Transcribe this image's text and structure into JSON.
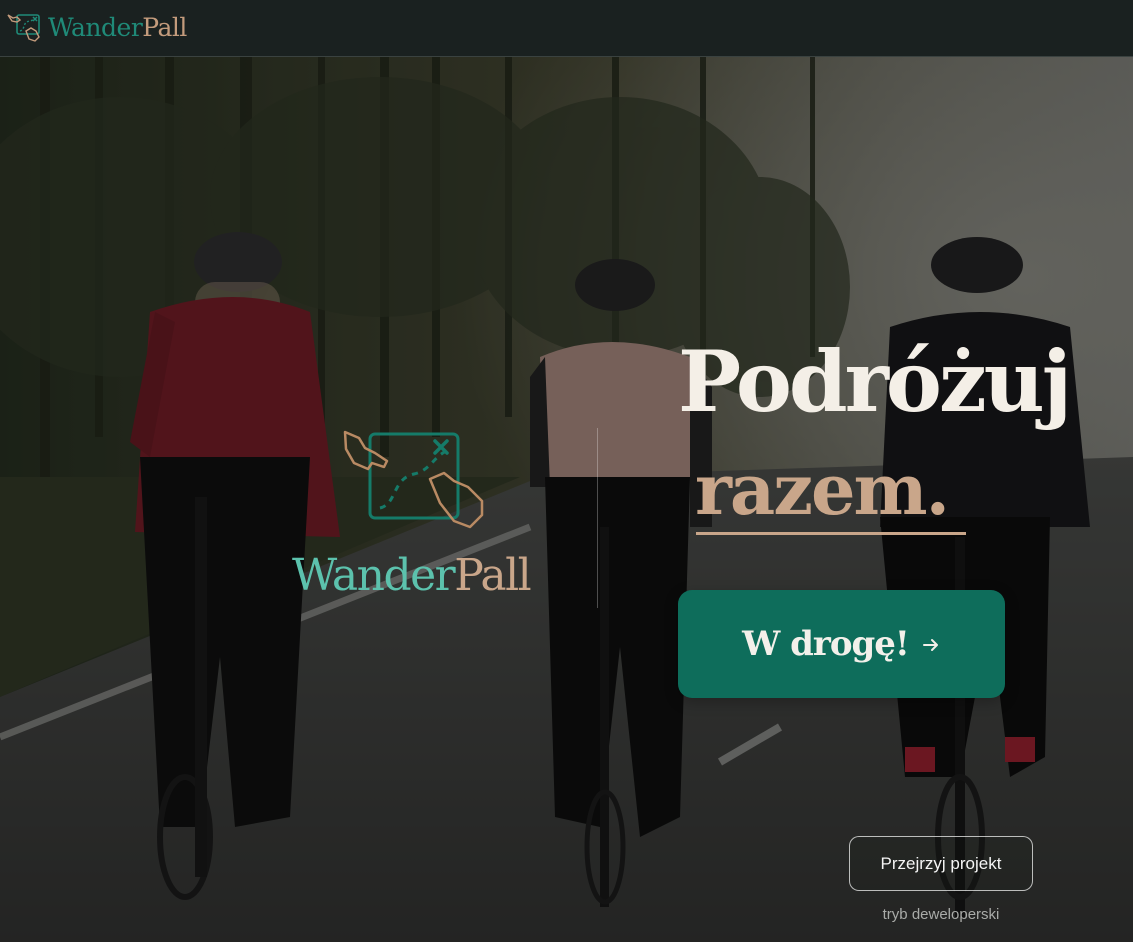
{
  "navbar": {
    "logo_part1": "Wander",
    "logo_part2": "Pall",
    "logo_icon": "map-route-hands-icon"
  },
  "hero": {
    "background": "cyclists-on-road-photo",
    "brand_icon": "map-route-hands-icon",
    "brand_part1": "Wander",
    "brand_part2": "Pall",
    "headline_line1": "Podróżuj",
    "headline_line2": "razem.",
    "cta_label": "W drogę!",
    "cta_icon": "arrow-right-icon",
    "project_button_label": "Przejrzyj projekt",
    "dev_mode_label": "tryb deweloperski"
  },
  "colors": {
    "navbar_bg": "#1a2120",
    "brand_green": "#0e6d5b",
    "brand_teal_light": "#5cc2ad",
    "brand_tan": "#c9a68a",
    "headline_white": "#f4efe7"
  }
}
